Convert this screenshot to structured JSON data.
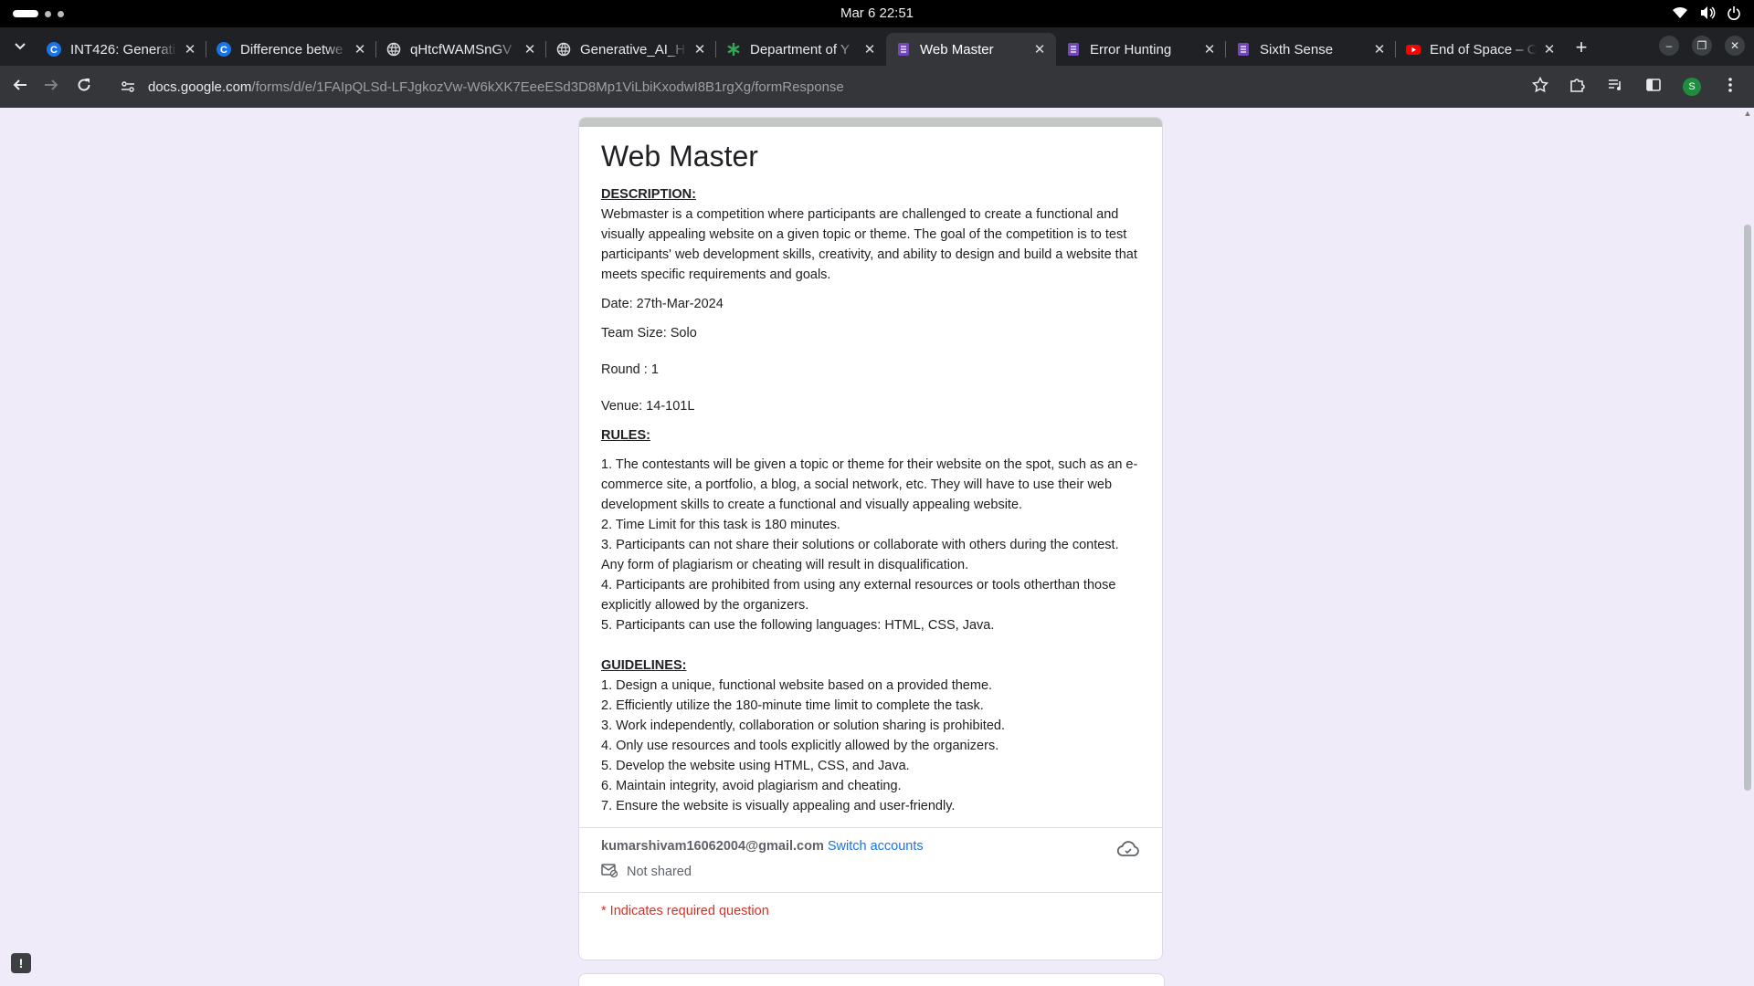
{
  "system": {
    "clock": "Mar 6  22:51"
  },
  "tabs": [
    {
      "title": "INT426: Generati",
      "icon": "c-logo-icon"
    },
    {
      "title": "Difference betwe",
      "icon": "c-logo-icon"
    },
    {
      "title": "qHtcfWAMSnGV",
      "icon": "globe-icon"
    },
    {
      "title": "Generative_AI_H",
      "icon": "globe-icon"
    },
    {
      "title": "Department of Y",
      "icon": "asterisk-icon"
    },
    {
      "title": "Web Master",
      "icon": "forms-icon",
      "active": true
    },
    {
      "title": "Error Hunting",
      "icon": "forms-icon"
    },
    {
      "title": "Sixth Sense",
      "icon": "forms-icon"
    },
    {
      "title": "End of Space – C",
      "icon": "youtube-icon"
    }
  ],
  "toolbar": {
    "url_host": "docs.google.com",
    "url_path": "/forms/d/e/1FAIpQLSd-LFJgkozVw-W6kXK7EeeESd3D8Mp1ViLbiKxodwI8B1rgXg/formResponse",
    "avatar_letter": "S"
  },
  "form": {
    "title": "Web Master",
    "description_heading": "DESCRIPTION:",
    "description": "Webmaster is a competition where participants are challenged to create a functional and visually appealing website on a given topic or theme. The goal of the competition is to test participants' web development skills, creativity, and ability to design and build a website that meets specific requirements and goals.",
    "date": "Date:  27th-Mar-2024",
    "team_size": "Team Size: Solo",
    "round": "Round : 1",
    "venue": "Venue: 14-101L",
    "rules_heading": "RULES:",
    "rules": [
      "1. The contestants will be given a topic or theme for their website on the spot, such as an e-commerce site, a portfolio, a blog, a social network, etc. They will have to use their web development skills to create a functional and visually appealing website.",
      "2. Time Limit for this task is 180 minutes.",
      "3. Participants can not share their solutions or collaborate with others during the contest. Any form of plagiarism or cheating will result in disqualification.",
      "4. Participants are prohibited from using any external resources or tools otherthan those explicitly allowed by the organizers.",
      "5. Participants can use the following languages: HTML, CSS, Java."
    ],
    "guidelines_heading": "GUIDELINES:",
    "guidelines": [
      "1. Design a unique, functional website based on a provided theme.",
      "2. Efficiently utilize the 180-minute time limit to complete the task.",
      "3. Work independently, collaboration or solution sharing is prohibited.",
      "4. Only use resources and tools explicitly allowed by the organizers.",
      "5. Develop the website using HTML, CSS, and Java.",
      "6. Maintain integrity, avoid plagiarism and cheating.",
      "7. Ensure the website is visually appealing and user-friendly."
    ],
    "account_email": "kumarshivam16062004@gmail.com",
    "switch_accounts": "Switch accounts",
    "not_shared": "Not shared",
    "required_note": "* Indicates required question"
  },
  "colors": {
    "accent": "#1a73e8",
    "required": "#d93025",
    "page_bg": "#f0ebf8"
  }
}
